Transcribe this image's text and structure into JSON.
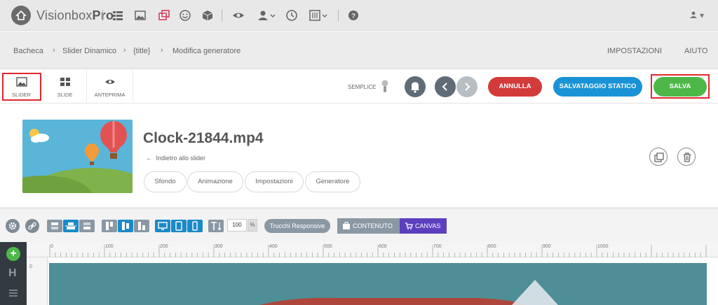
{
  "app": {
    "brand_light": "Visionbox",
    "brand_bold": "Pro"
  },
  "topbar": {
    "icons": [
      "list-icon",
      "image-icon",
      "layers-icon",
      "smiley-icon",
      "cube-icon",
      "eye-icon",
      "user-icon",
      "clock-icon",
      "sliders-icon",
      "help-icon"
    ],
    "user_caret": "▾"
  },
  "breadcrumb": {
    "items": [
      "Bacheca",
      "Slider Dinamico",
      "{title}",
      "Modifica generatore"
    ],
    "right_links": [
      "IMPOSTAZIONI",
      "AIUTO"
    ]
  },
  "toolbar": {
    "tabs": [
      {
        "label": "SLIDER",
        "icon": "image-icon"
      },
      {
        "label": "SLIDE",
        "icon": "grid-icon"
      },
      {
        "label": "ANTEPRIMA",
        "icon": "eye-icon"
      }
    ],
    "semplice_label": "SEMPLICE",
    "annulla_label": "ANNULLA",
    "salvataggio_label": "SALVATAGGIO STATICO",
    "salva_label": "SALVA",
    "annotation_1": "1",
    "annotation_2": "2",
    "colors": {
      "annulla": "#d33b3b",
      "salvataggio": "#1a93d6",
      "salva": "#4db848",
      "annotation": "#e0282e"
    }
  },
  "info": {
    "file_title": "Clock-21844.mp4",
    "back_link": "Indietro allo slider",
    "subtabs": [
      "Sfondo",
      "Animazione",
      "Impostazioni",
      "Generatore"
    ]
  },
  "editor": {
    "zoom_value": "100",
    "zoom_unit": "%",
    "trucchi_label": "Trucchi Responsive",
    "contenuto_label": "CONTENUTO",
    "canvas_label": "CANVAS",
    "leftbar_letter": "H",
    "ruler_ticks": [
      "0",
      "100",
      "200",
      "300",
      "400",
      "500",
      "600",
      "700",
      "800",
      "900",
      "1000"
    ],
    "vruler_tick": "0"
  }
}
